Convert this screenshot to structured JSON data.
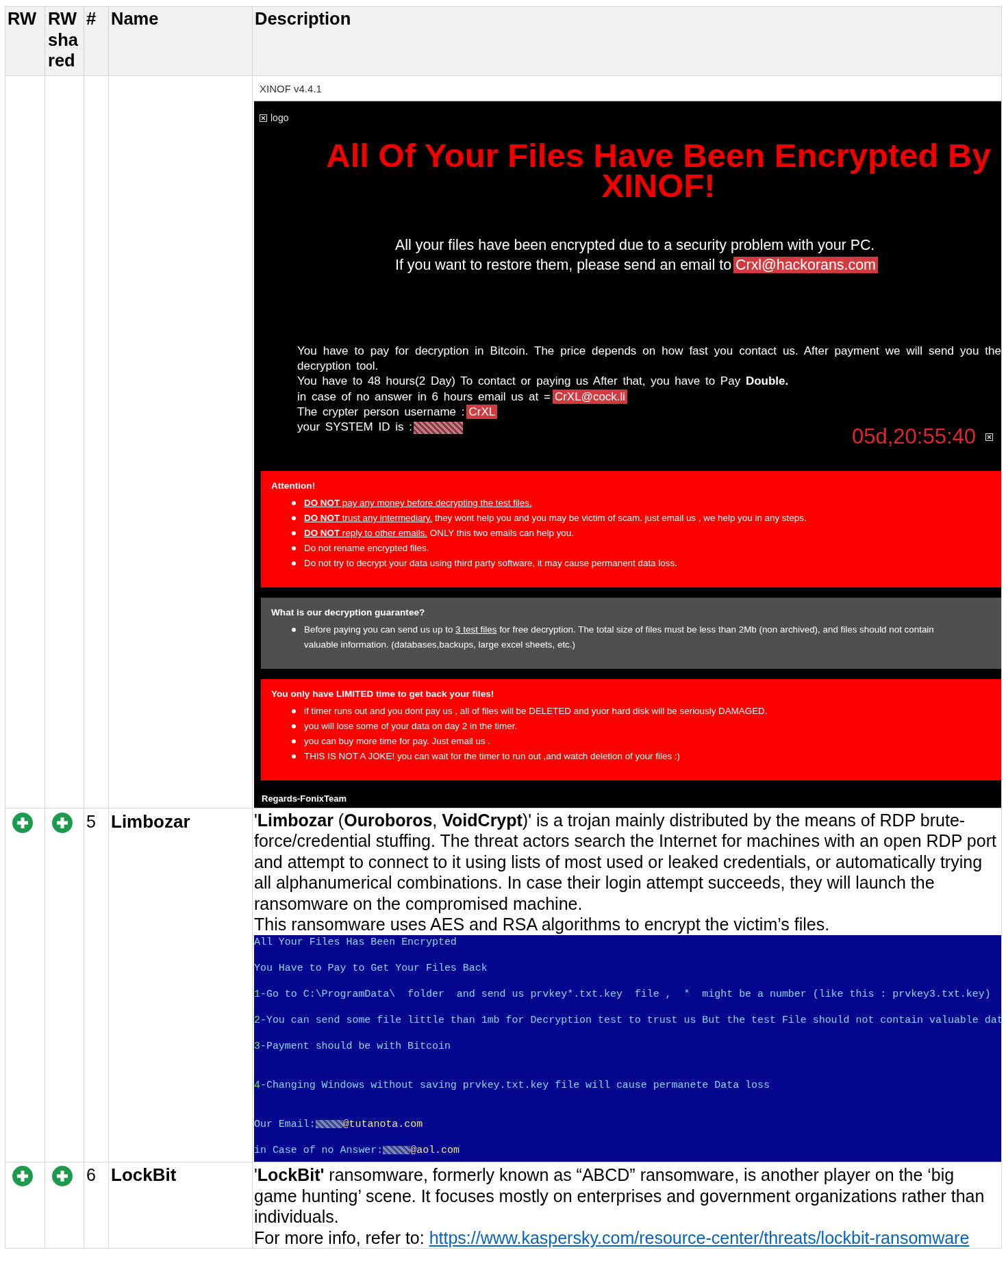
{
  "table": {
    "columns": [
      "RW",
      "RW shared",
      "#",
      "Name",
      "Description"
    ],
    "rows": [
      {
        "note": {
          "kind": "xinof",
          "window_title": "XINOF v4.4.1",
          "logo_alt": "logo",
          "headline": "All Of Your Files Have Been Encrypted By XINOF!",
          "intro": [
            {
              "text": "All your files have been encrypted due to a security problem with your PC."
            },
            {
              "text": "If you want to restore them, please send an email to",
              "highlight": "Crxl@hackorans.com"
            }
          ],
          "details": [
            {
              "text": "You have to pay for decryption in Bitcoin. The price depends on how fast you contact us. After payment we will send you the decryption tool."
            },
            {
              "text": "You have to 48 hours(2 Day) To contact or paying us After that, you have to Pay **Double.**"
            },
            {
              "text": "in case of no answer in 6 hours email us at =",
              "highlight": "CrXL@cock.li"
            },
            {
              "text": "The crypter person username :",
              "highlight": "CrXL"
            },
            {
              "text": "your SYSTEM ID is :",
              "redacted": true
            }
          ],
          "timer": "05d,20:55:40",
          "sections": [
            {
              "kind": "alert",
              "title": "Attention!",
              "items": [
                [
                  {
                    "text": "DO NOT",
                    "kind": "warning"
                  },
                  {
                    "text": " pay any money before decrypting the test files.",
                    "kind": "underlined"
                  }
                ],
                [
                  {
                    "text": "DO NOT",
                    "kind": "warning"
                  },
                  {
                    "text": " trust any intermediary.",
                    "kind": "underlined"
                  },
                  {
                    "text": " they wont help you and you may be victim of scam. just email us , we help you in any steps.",
                    "kind": "plain"
                  }
                ],
                [
                  {
                    "text": "DO NOT",
                    "kind": "warning"
                  },
                  {
                    "text": " reply to other emails.",
                    "kind": "underlined"
                  },
                  {
                    "text": " ONLY this two emails can help you.",
                    "kind": "plain"
                  }
                ],
                [
                  {
                    "text": "Do not rename encrypted files.",
                    "kind": "plain"
                  }
                ],
                [
                  {
                    "text": "Do not try to decrypt your data using third party software, it may cause permanent data loss.",
                    "kind": "plain"
                  }
                ]
              ]
            },
            {
              "kind": "info",
              "title": "What is our decryption guarantee?",
              "items": [
                [
                  {
                    "text": "Before paying you can send us up to ",
                    "kind": "plain"
                  },
                  {
                    "text": "3 test files",
                    "kind": "underlined"
                  },
                  {
                    "text": " for free decryption. The total size of files must be less than 2Mb (non archived), and files should not contain valuable information. (databases,backups, large excel sheets, etc.)",
                    "kind": "plain"
                  }
                ]
              ]
            },
            {
              "kind": "alert",
              "title": "You only have LIMITED time to get back your files!",
              "items": [
                [
                  {
                    "text": "if timer runs out and you dont pay us , all of files will be DELETED and yuor hard disk will be seriously DAMAGED.",
                    "kind": "plain"
                  }
                ],
                [
                  {
                    "text": "you will lose some of your data on day 2 in the timer.",
                    "kind": "plain"
                  }
                ],
                [
                  {
                    "text": "you can buy more time for pay. Just email us .",
                    "kind": "plain"
                  }
                ],
                [
                  {
                    "text": "THIS IS NOT A JOKE! you can wait for the timer to run out ,and watch deletion of your files :)",
                    "kind": "plain"
                  }
                ]
              ]
            }
          ],
          "signature": "Regards-FonixTeam"
        }
      },
      {
        "rw": true,
        "rw_shared": true,
        "number": "5",
        "name": "Limbozar",
        "paragraphs": [
          "'**Limbozar** (**Ouroboros**, **VoidCrypt**)' is a trojan mainly distributed by the means of RDP brute-force/credential stuffing. The threat actors search the Internet for machines with an open RDP port and attempt to connect to it using lists of most used or leaked credentials, or automatically trying all alphanumerical combinations. In case their login attempt succeeds, they will launch the ransomware on the compromised machine.",
          "This ransomware uses AES and RSA algorithms to encrypt the victim’s files."
        ],
        "note": {
          "kind": "console",
          "lines": [
            {
              "kind": "text",
              "text": "All Your Files Has Been Encrypted"
            },
            {
              "kind": "text",
              "text": "You Have to Pay to Get Your Files Back"
            },
            {
              "kind": "numbered",
              "number": "1",
              "text": "-Go to C:\\ProgramData\\  folder  and send us prvkey*.txt.key  file ,  *  might be a number (like this : prvkey3.txt.key)"
            },
            {
              "kind": "numbered",
              "number": "2",
              "text": "-You can send some file little than 1mb for Decryption test to trust us But the test File should not contain valuable dat"
            },
            {
              "kind": "numbered",
              "number": "3",
              "text": "-Payment should be with Bitcoin"
            },
            {
              "kind": "numbered",
              "number": "4",
              "text": "-Changing Windows without saving prvkey.txt.key file will cause permanete Data loss"
            },
            {
              "kind": "email",
              "label": "Our Email:",
              "value": "@tutanota.com"
            },
            {
              "kind": "email",
              "label": "in Case of no Answer:",
              "value": "@aol.com"
            }
          ]
        }
      },
      {
        "rw": true,
        "rw_shared": true,
        "number": "6",
        "name": "LockBit",
        "paragraphs": [
          "'**LockBit'** ransomware, formerly known as “ABCD” ransomware, is another player on the ‘big game hunting’ scene. It focuses mostly on enterprises and government organizations rather than individuals."
        ],
        "link_intro": "For more info, refer to:",
        "link": "https://www.kaspersky.com/resource-center/threats/lockbit-ransomware"
      }
    ]
  }
}
